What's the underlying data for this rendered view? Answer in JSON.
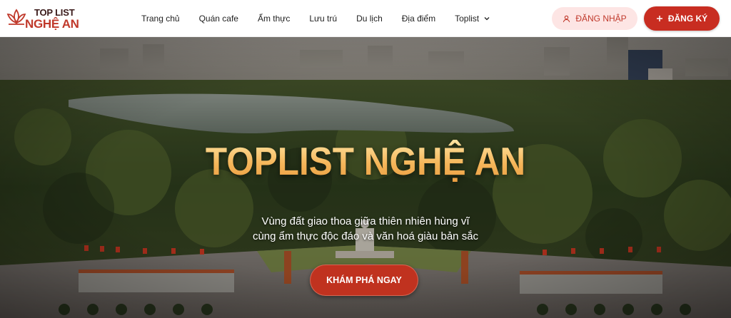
{
  "logo": {
    "line1": "TOP LIST",
    "line2": "NGHỆ AN",
    "icon": "lotus-logo-icon",
    "colors": {
      "primary": "#c0392b",
      "dark": "#3a1a1a"
    }
  },
  "nav": {
    "items": [
      {
        "label": "Trang chủ"
      },
      {
        "label": "Quán cafe"
      },
      {
        "label": "Ẩm thực"
      },
      {
        "label": "Lưu trú"
      },
      {
        "label": "Du lịch"
      },
      {
        "label": "Địa điểm"
      },
      {
        "label": "Toplist",
        "icon": "chevron-down-icon"
      }
    ]
  },
  "auth": {
    "login_label": "ĐĂNG NHẬP",
    "login_icon": "user-icon",
    "register_label": "ĐĂNG KÝ",
    "register_icon": "plus-icon"
  },
  "hero": {
    "title": "TOPLIST NGHỆ AN",
    "subtitle_line1": "Vùng đất giao thoa giữa thiên nhiên hùng vĩ",
    "subtitle_line2": "cùng ẩm thực độc đáo và văn hoá giàu bản sắc",
    "cta_label": "KHÁM PHÁ NGAY"
  },
  "theme": {
    "accent": "#c82d21",
    "accent_soft": "#fde5e4",
    "title_gold": "#f5b65a"
  }
}
